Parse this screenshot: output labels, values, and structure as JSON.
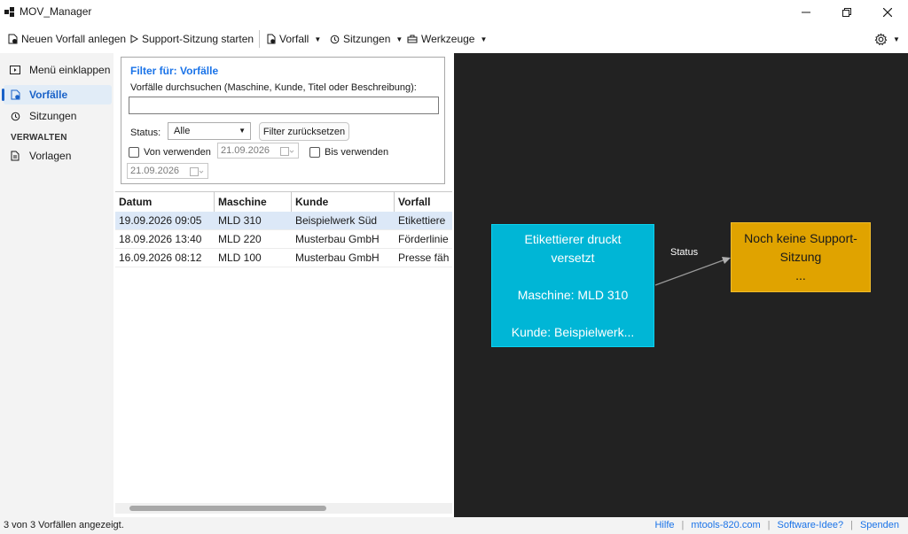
{
  "window": {
    "title": "MOV_Manager"
  },
  "toolbar": {
    "new_incident": "Neuen Vorfall anlegen",
    "start_support": "Support-Sitzung starten",
    "incident_menu": "Vorfall",
    "sessions_menu": "Sitzungen",
    "tools_menu": "Werkzeuge"
  },
  "sidebar": {
    "collapse": "Menü einklappen",
    "incidents": "Vorfälle",
    "sessions": "Sitzungen",
    "section_manage": "VERWALTEN",
    "templates": "Vorlagen"
  },
  "filter": {
    "title": "Filter für: Vorfälle",
    "search_label": "Vorfälle durchsuchen (Maschine, Kunde, Titel oder Beschreibung):",
    "search_value": "",
    "status_label": "Status:",
    "status_value": "Alle",
    "reset_label": "Filter zurücksetzen",
    "from_label": "Von verwenden",
    "from_date": "21.09.2026",
    "to_label": "Bis verwenden",
    "to_date": "21.09.2026"
  },
  "table": {
    "columns": [
      "Datum",
      "Maschine",
      "Kunde",
      "Vorfall"
    ],
    "rows": [
      [
        "19.09.2026 09:05",
        "MLD 310",
        "Beispielwerk Süd",
        "Etikettiere"
      ],
      [
        "18.09.2026 13:40",
        "MLD 220",
        "Musterbau GmbH",
        "Förderlinie"
      ],
      [
        "16.09.2026 08:12",
        "MLD 100",
        "Musterbau GmbH",
        "Presse fäh"
      ]
    ]
  },
  "graph": {
    "node_a": {
      "line1": "Etikettierer druckt",
      "line2": "versetzt",
      "line3": "Maschine: MLD 310",
      "line4": "Kunde: Beispielwerk..."
    },
    "edge_label": "Status",
    "node_b": {
      "line1": "Noch keine Support-",
      "line2": "Sitzung",
      "line3": "..."
    },
    "colors": {
      "background": "#222222",
      "node_a": "#00b6d6",
      "node_b": "#e0a300"
    }
  },
  "statusbar": {
    "text": "3 von 3 Vorfällen angezeigt.",
    "help": "Hilfe",
    "site": "mtools-820.com",
    "idea": "Software-Idee?",
    "donate": "Spenden",
    "separator": "|"
  },
  "colors": {
    "accent": "#1a73e8"
  }
}
